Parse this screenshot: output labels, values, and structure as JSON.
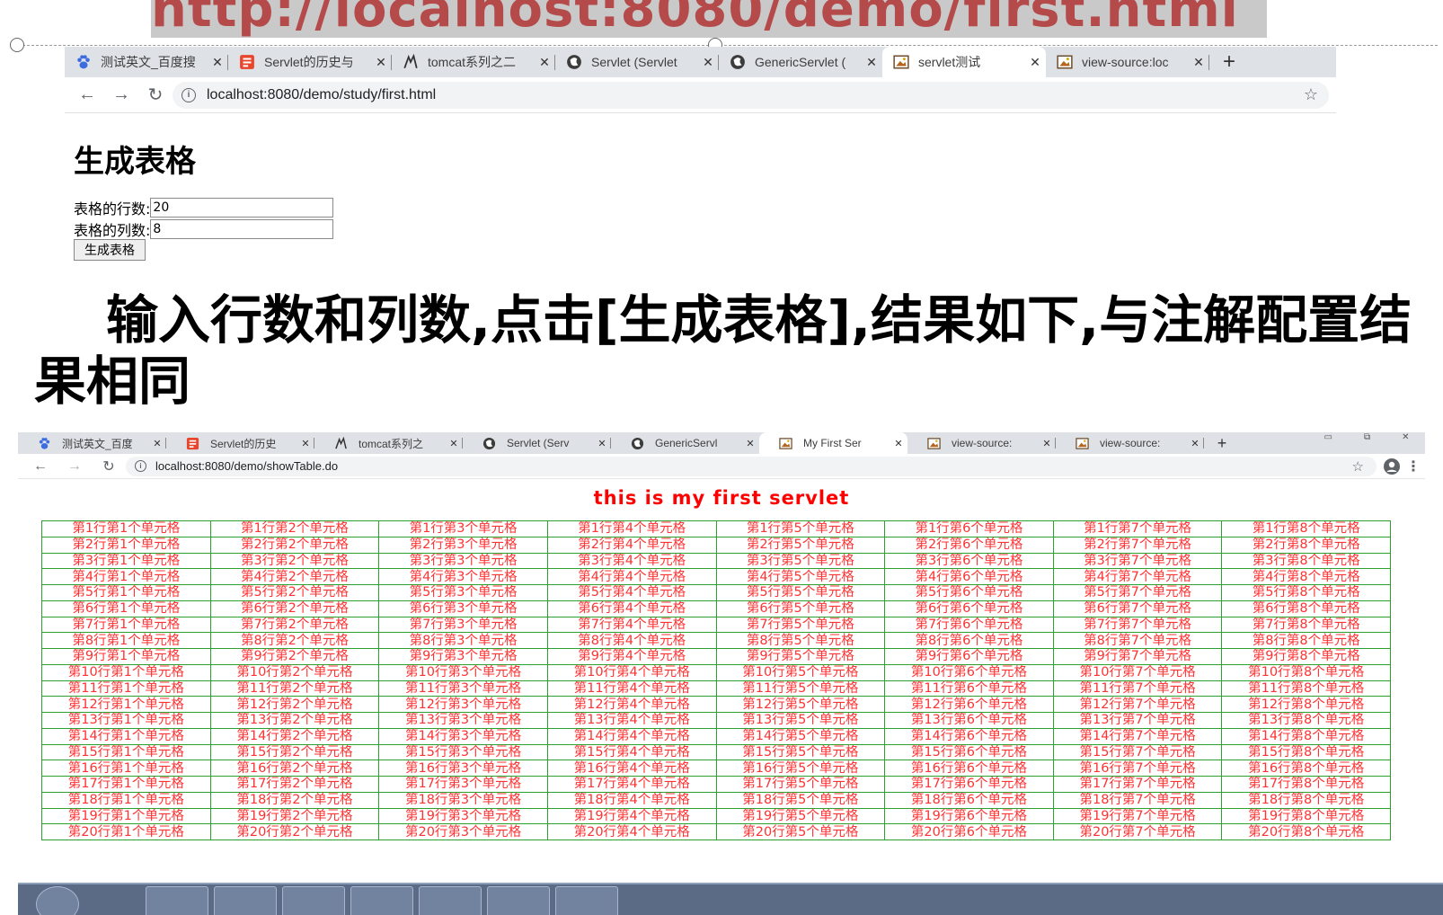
{
  "banner": {
    "url": "http://localhost:8080/demo/first.html"
  },
  "browser1": {
    "tabs": [
      {
        "title": "测试英文_百度搜",
        "icon": "baidu-paw-icon"
      },
      {
        "title": "Servlet的历史与",
        "icon": "red-bookmark-icon"
      },
      {
        "title": "tomcat系列之二",
        "icon": "tomcat-cat-icon"
      },
      {
        "title": "Servlet (Servlet",
        "icon": "globe-icon"
      },
      {
        "title": "GenericServlet (",
        "icon": "globe-icon"
      },
      {
        "title": "servlet测试",
        "icon": "image-page-icon",
        "active": true
      },
      {
        "title": "view-source:loc",
        "icon": "image-page-icon"
      }
    ],
    "address": "localhost:8080/demo/study/first.html"
  },
  "form": {
    "heading": "生成表格",
    "rows_label": "表格的行数:",
    "rows_value": "20",
    "cols_label": "表格的列数:",
    "cols_value": "8",
    "button": "生成表格"
  },
  "caption": "输入行数和列数,点击[生成表格],结果如下,与注解配置结果相同",
  "browser2": {
    "tabs": [
      {
        "title": "测试英文_百度",
        "icon": "baidu-paw-icon"
      },
      {
        "title": "Servlet的历史",
        "icon": "red-bookmark-icon"
      },
      {
        "title": "tomcat系列之",
        "icon": "tomcat-cat-icon"
      },
      {
        "title": "Servlet (Serv",
        "icon": "globe-icon"
      },
      {
        "title": "GenericServl",
        "icon": "globe-icon"
      },
      {
        "title": "My First Ser",
        "icon": "image-page-icon",
        "active": true
      },
      {
        "title": "view-source:",
        "icon": "image-page-icon"
      },
      {
        "title": "view-source:",
        "icon": "image-page-icon"
      }
    ],
    "address": "localhost:8080/demo/showTable.do"
  },
  "result": {
    "title": "this is my first servlet",
    "rows": 20,
    "cols": 8,
    "cell_template": "第{r}行第{c}个单元格"
  },
  "colors": {
    "accent_red": "#ff3333",
    "grid_green": "#2ea02e",
    "banner_text": "#b54a4a"
  }
}
